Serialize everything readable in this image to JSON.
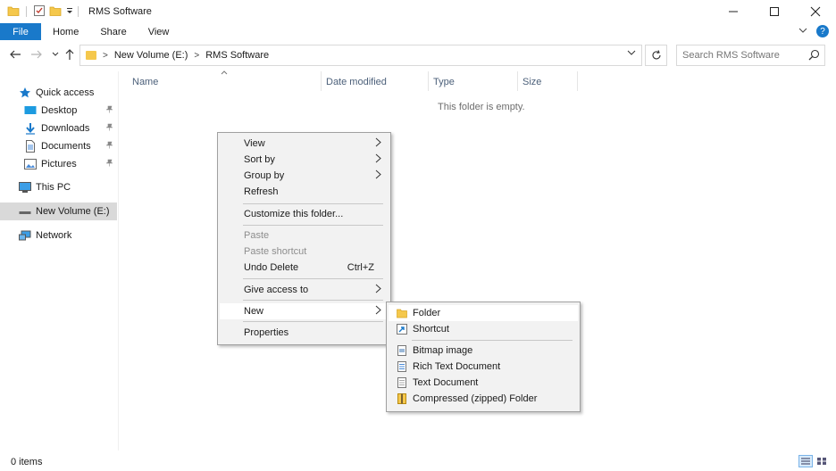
{
  "window": {
    "title": "RMS Software",
    "minimize_glyph": "—",
    "maximize_glyph": "☐",
    "close_glyph": "✕"
  },
  "ribbon": {
    "tabs": [
      "File",
      "Home",
      "Share",
      "View"
    ],
    "expand_glyph": "⌄",
    "help_glyph": "?"
  },
  "address": {
    "crumbs": [
      "New Volume (E:)",
      "RMS Software"
    ],
    "crumb_sep": ">",
    "dropdown_glyph": "⌄",
    "refresh_glyph": "↻"
  },
  "search": {
    "placeholder": "Search RMS Software"
  },
  "nav": {
    "quick_access": "Quick access",
    "items": [
      {
        "label": "Desktop",
        "icon": "desktop-icon",
        "pinned": true
      },
      {
        "label": "Downloads",
        "icon": "downloads-icon",
        "pinned": true
      },
      {
        "label": "Documents",
        "icon": "documents-icon",
        "pinned": true
      },
      {
        "label": "Pictures",
        "icon": "pictures-icon",
        "pinned": true
      }
    ],
    "this_pc": "This PC",
    "volume": "New Volume (E:)",
    "network": "Network"
  },
  "columns": [
    "Name",
    "Date modified",
    "Type",
    "Size"
  ],
  "empty_message": "This folder is empty.",
  "context_menu": {
    "items": [
      {
        "label": "View",
        "submenu": true
      },
      {
        "label": "Sort by",
        "submenu": true
      },
      {
        "label": "Group by",
        "submenu": true
      },
      {
        "label": "Refresh"
      },
      {
        "label": "Customize this folder..."
      },
      {
        "label": "Paste",
        "disabled": true
      },
      {
        "label": "Paste shortcut",
        "disabled": true
      },
      {
        "label": "Undo Delete",
        "shortcut": "Ctrl+Z"
      },
      {
        "label": "Give access to",
        "submenu": true
      },
      {
        "label": "New",
        "submenu": true,
        "highlighted": true
      },
      {
        "label": "Properties"
      }
    ]
  },
  "new_submenu": {
    "items": [
      {
        "label": "Folder",
        "icon": "folder-icon",
        "highlighted": true
      },
      {
        "label": "Shortcut",
        "icon": "shortcut-icon"
      },
      {
        "label": "Bitmap image",
        "icon": "bitmap-icon"
      },
      {
        "label": "Rich Text Document",
        "icon": "rtf-icon"
      },
      {
        "label": "Text Document",
        "icon": "text-document-icon"
      },
      {
        "label": "Compressed (zipped) Folder",
        "icon": "zip-folder-icon"
      }
    ]
  },
  "status": {
    "item_count": "0 items"
  },
  "colors": {
    "accent": "#1979ca",
    "folder": "#f5c84c",
    "menu_bg": "#f2f2f2",
    "menu_highlight": "#ffffff"
  }
}
